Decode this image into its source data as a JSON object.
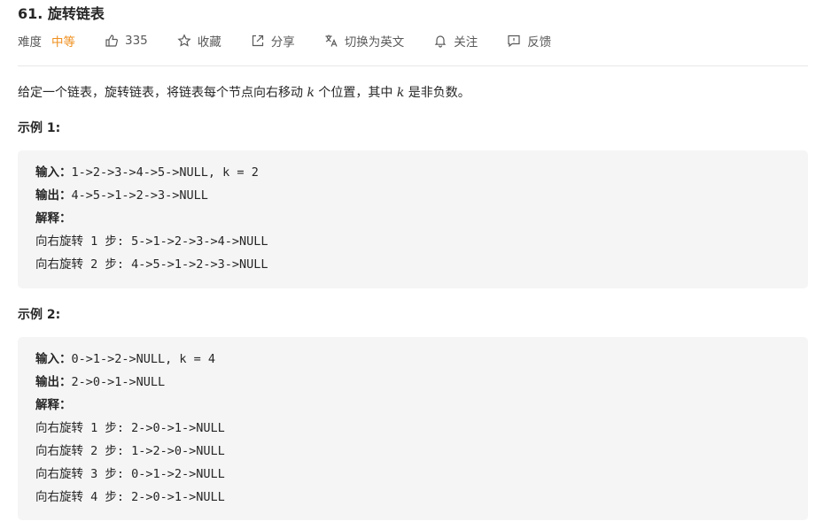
{
  "problem": {
    "title": "61. 旋转链表",
    "difficulty_label": "难度",
    "difficulty_value": "中等",
    "like_count": "335",
    "collect_label": "收藏",
    "share_label": "分享",
    "translate_label": "切换为英文",
    "follow_label": "关注",
    "feedback_label": "反馈"
  },
  "description": {
    "part1": "给定一个链表，旋转链表，将链表每个节点向右移动 ",
    "var1": "k",
    "part2": " 个位置，其中 ",
    "var2": "k",
    "part3": " 是非负数。"
  },
  "examples": [
    {
      "heading": "示例 1:",
      "input_key": "输入：",
      "input_value": "1->2->3->4->5->NULL, k = 2",
      "output_key": "输出：",
      "output_value": "4->5->1->2->3->NULL",
      "explain_key": "解释：",
      "steps": [
        {
          "label": "向右旋转",
          "text": " 1 步: 5->1->2->3->4->NULL"
        },
        {
          "label": "向右旋转",
          "text": " 2 步: 4->5->1->2->3->NULL"
        }
      ]
    },
    {
      "heading": "示例 2:",
      "input_key": "输入：",
      "input_value": "0->1->2->NULL, k = 4",
      "output_key": "输出：",
      "output_value": "2->0->1->NULL",
      "explain_key": "解释：",
      "steps": [
        {
          "label": "向右旋转",
          "text": " 1 步: 2->0->1->NULL"
        },
        {
          "label": "向右旋转",
          "text": " 2 步: 1->2->0->NULL"
        },
        {
          "label": "向右旋转",
          "text": " 3 步: 0->1->2->NULL"
        },
        {
          "label": "向右旋转",
          "text": " 4 步: 2->0->1->NULL"
        }
      ]
    }
  ],
  "colors": {
    "difficulty_medium": "#ef8f1e",
    "code_background": "#f5f5f5",
    "text": "#262626",
    "meta_text": "#595959"
  },
  "icons": [
    "thumbs-up-icon",
    "star-icon",
    "share-icon",
    "translate-icon",
    "bell-icon",
    "feedback-icon"
  ]
}
